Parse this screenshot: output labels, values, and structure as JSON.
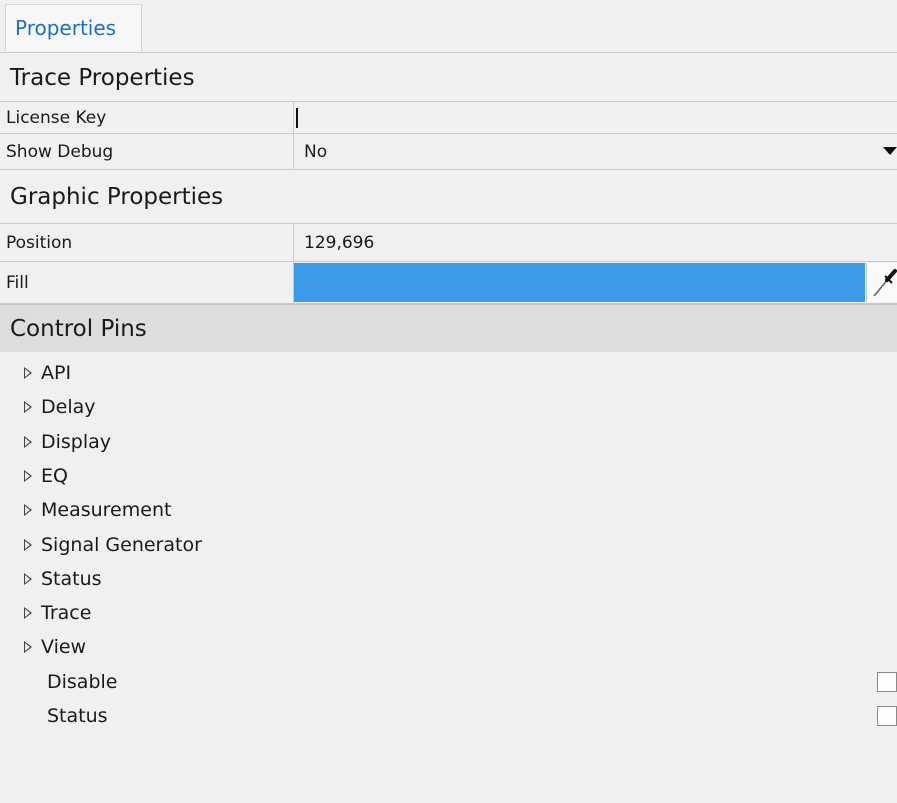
{
  "tabs": [
    {
      "label": "Properties"
    }
  ],
  "sections": {
    "trace": {
      "title": "Trace Properties",
      "license_key": {
        "label": "License Key",
        "value": ""
      },
      "show_debug": {
        "label": "Show Debug",
        "value": "No"
      }
    },
    "graphic": {
      "title": "Graphic Properties",
      "position": {
        "label": "Position",
        "value": "129,696"
      },
      "fill": {
        "label": "Fill",
        "color": "#3d9ae8"
      }
    },
    "control_pins": {
      "title": "Control Pins",
      "groups": [
        "API",
        "Delay",
        "Display",
        "EQ",
        "Measurement",
        "Signal Generator",
        "Status",
        "Trace",
        "View"
      ],
      "pins": [
        {
          "label": "Disable",
          "checked": false
        },
        {
          "label": "Status",
          "checked": false
        }
      ]
    }
  },
  "icons": {
    "dropdown": "chevron-down-icon",
    "color_picker": "eyedropper-icon",
    "expand": "triangle-right-icon"
  }
}
